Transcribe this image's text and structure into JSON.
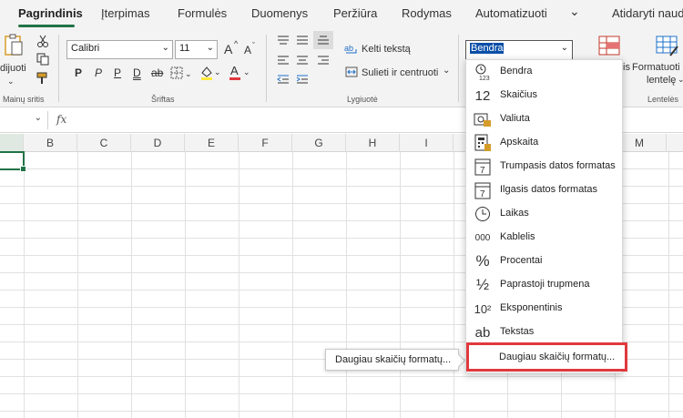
{
  "tabs": [
    "Pagrindinis",
    "Įterpimas",
    "Formulės",
    "Duomenys",
    "Peržiūra",
    "Rodymas",
    "Automatizuoti"
  ],
  "tabs_overflow": "⌄",
  "open_in_desktop": "Atidaryti naud",
  "ribbon": {
    "clipboard": {
      "paste_label": "dijuoti",
      "label": "Mainų sritis"
    },
    "font": {
      "name": "Calibri",
      "size": "11",
      "grow": "A",
      "shrink": "A",
      "bold": "P",
      "italic": "P",
      "underline": "P",
      "dunderline": "D",
      "strike": "ab",
      "label": "Šriftas"
    },
    "alignment": {
      "wrap": "Kelti tekstą",
      "merge": "Sulieti ir centruoti",
      "label": "Lygiuotė"
    },
    "number": {
      "format_value": "Bendra"
    },
    "styles": {
      "partial": "is",
      "format_table": "Formatuoti",
      "format_table2": "lentelę",
      "label": "Lentelės"
    }
  },
  "formula_bar": {
    "fx": "fx"
  },
  "columns": [
    "B",
    "C",
    "D",
    "E",
    "F",
    "G",
    "H",
    "I",
    "M"
  ],
  "number_formats": [
    {
      "icon": "123",
      "label": "Bendra"
    },
    {
      "icon": "12",
      "label": "Skaičius"
    },
    {
      "icon": "€",
      "label": "Valiuta"
    },
    {
      "icon": "▦",
      "label": "Apskaita"
    },
    {
      "icon": "7",
      "label": "Trumpasis datos formatas"
    },
    {
      "icon": "7",
      "label": "Ilgasis datos formatas"
    },
    {
      "icon": "◷",
      "label": "Laikas"
    },
    {
      "icon": "000",
      "label": "Kablelis"
    },
    {
      "icon": "%",
      "label": "Procentai"
    },
    {
      "icon": "½",
      "label": "Paprastoji trupmena"
    },
    {
      "icon": "10²",
      "label": "Eksponentinis"
    },
    {
      "icon": "ab",
      "label": "Tekstas"
    }
  ],
  "more_formats": "Daugiau skaičių formatų...",
  "tooltip": "Daugiau skaičių formatų...",
  "colors": {
    "accent": "#217346",
    "highlight": "#e0393e"
  }
}
